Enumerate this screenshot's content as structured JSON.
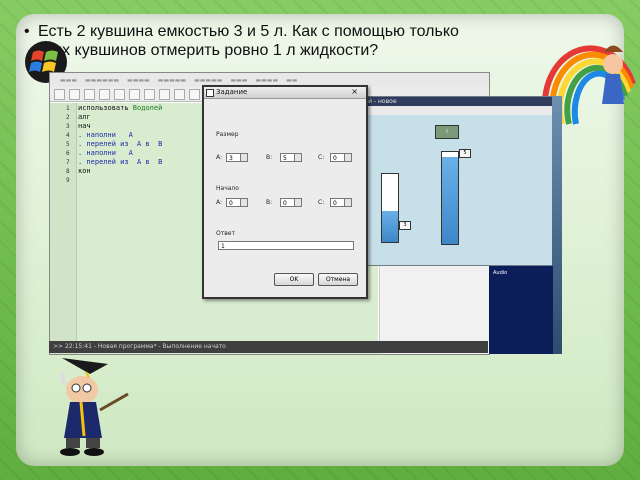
{
  "slide": {
    "bullet": "•",
    "text_line1": "Есть 2 кувшина емкостью 3 и 5 л. Как с помощью только",
    "text_line2": "этих кувшинов отмерить ровно 1 л жидкости?"
  },
  "code_editor": {
    "line_numbers": [
      "1",
      "2",
      "3",
      "4",
      "5",
      "6",
      "7",
      "8",
      "9"
    ],
    "lines": [
      {
        "text": "использовать ",
        "kw": "Водолей"
      },
      {
        "text": "алг"
      },
      {
        "text": "нач"
      },
      {
        "text": ". наполни   А"
      },
      {
        "text": ". перелей из  А в  В"
      },
      {
        "text": ". наполни   А"
      },
      {
        "text": ". перелей из  А в  В"
      },
      {
        "text": "кон"
      }
    ]
  },
  "jug_window": {
    "title": "Водолей - новое",
    "jug_a_label": "3",
    "jug_b_label": "5",
    "jug_a_fill": 0.45,
    "jug_b_fill": 0.95
  },
  "dialog": {
    "title": "Задание",
    "close": "×",
    "size_label": "Размер",
    "start_label": "Начало",
    "answer_label": "Ответ",
    "size_a_label": "A:",
    "size_b_label": "B:",
    "size_c_label": "C:",
    "start_a_label": "A:",
    "start_b_label": "B:",
    "start_c_label": "C:",
    "size_a": "3",
    "size_b": "5",
    "size_c": "0",
    "start_a": "0",
    "start_b": "0",
    "start_c": "0",
    "answer_value": "1",
    "ok_label": "OK",
    "cancel_label": "Отмена"
  },
  "dark_panel_label": "Audio",
  "status_text": ">> 22:15:41 - Новая программа* - Выполнение начато"
}
